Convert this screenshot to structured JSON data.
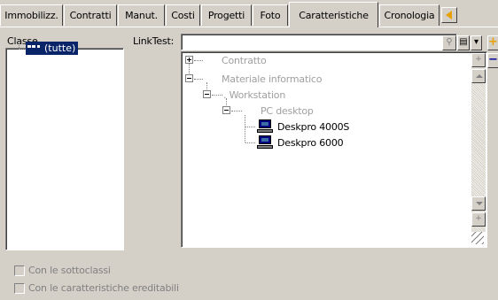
{
  "tabs": [
    {
      "label": "Immobilizz."
    },
    {
      "label": "Contratti"
    },
    {
      "label": "Manut."
    },
    {
      "label": "Costi"
    },
    {
      "label": "Progetti"
    },
    {
      "label": "Foto"
    },
    {
      "label": "Caratteristiche"
    },
    {
      "label": "Cronologia"
    }
  ],
  "left_panel": {
    "header": "Classe",
    "root_item": "(tutte)"
  },
  "linktest": {
    "label": "LinkTest:",
    "value": ""
  },
  "tree": [
    {
      "label": "Contratto"
    },
    {
      "label": "Materiale informatico"
    },
    {
      "label": ". Workstation"
    },
    {
      "label": "PC desktop"
    },
    {
      "label": "Deskpro 4000S"
    },
    {
      "label": "Deskpro 6000"
    }
  ],
  "checkboxes": {
    "subclasses": "Con le sottoclassi",
    "inherited": "Con le caratteristiche ereditabili"
  }
}
